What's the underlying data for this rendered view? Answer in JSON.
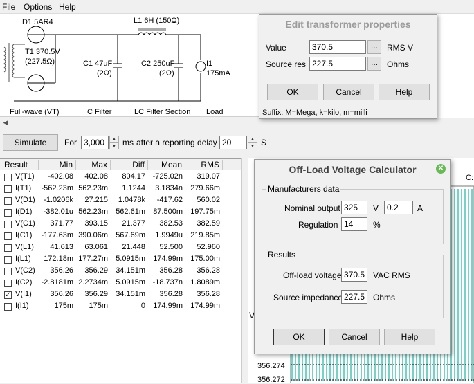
{
  "menu": {
    "file": "File",
    "options": "Options",
    "help": "Help"
  },
  "schematic": {
    "diode": "D1 5AR4",
    "transformer_line1": "T1 370.5V",
    "transformer_line2": "(227.5Ω)",
    "inductor": "L1 6H (150Ω)",
    "c1_line1": "C1 47uF",
    "c1_line2": "(2Ω)",
    "c2_line1": "C2 250uF",
    "c2_line2": "(2Ω)",
    "load_line1": "I1",
    "load_line2": "175mA",
    "caption_fullwave": "Full-wave (VT)",
    "caption_cfilter": "C Filter",
    "caption_lcfilter": "LC Filter Section",
    "caption_load": "Load"
  },
  "toolbar": {
    "simulate": "Simulate",
    "for_label": "For",
    "duration": "3,000",
    "ms_label": "ms",
    "delay_label": "after a reporting delay of",
    "delay": "20",
    "s_label": "S"
  },
  "table": {
    "headers": [
      "Result",
      "Min",
      "Max",
      "Diff",
      "Mean",
      "RMS"
    ],
    "rows": [
      {
        "checked": false,
        "name": "V(T1)",
        "min": "-402.08",
        "max": "402.08",
        "diff": "804.17",
        "mean": "-725.02n",
        "rms": "319.07"
      },
      {
        "checked": false,
        "name": "I(T1)",
        "min": "-562.23m",
        "max": "562.23m",
        "diff": "1.1244",
        "mean": "3.1834n",
        "rms": "279.66m"
      },
      {
        "checked": false,
        "name": "V(D1)",
        "min": "-1.0206k",
        "max": "27.215",
        "diff": "1.0478k",
        "mean": "-417.62",
        "rms": "560.02"
      },
      {
        "checked": false,
        "name": "I(D1)",
        "min": "-382.01u",
        "max": "562.23m",
        "diff": "562.61m",
        "mean": "87.500m",
        "rms": "197.75m"
      },
      {
        "checked": false,
        "name": "V(C1)",
        "min": "371.77",
        "max": "393.15",
        "diff": "21.377",
        "mean": "382.53",
        "rms": "382.59"
      },
      {
        "checked": false,
        "name": "I(C1)",
        "min": "-177.63m",
        "max": "390.06m",
        "diff": "567.69m",
        "mean": "1.9949u",
        "rms": "219.85m"
      },
      {
        "checked": false,
        "name": "V(L1)",
        "min": "41.613",
        "max": "63.061",
        "diff": "21.448",
        "mean": "52.500",
        "rms": "52.960"
      },
      {
        "checked": false,
        "name": "I(L1)",
        "min": "172.18m",
        "max": "177.27m",
        "diff": "5.0915m",
        "mean": "174.99m",
        "rms": "175.00m"
      },
      {
        "checked": false,
        "name": "V(C2)",
        "min": "356.26",
        "max": "356.29",
        "diff": "34.151m",
        "mean": "356.28",
        "rms": "356.28"
      },
      {
        "checked": false,
        "name": "I(C2)",
        "min": "-2.8181m",
        "max": "2.2734m",
        "diff": "5.0915m",
        "mean": "-18.737n",
        "rms": "1.8089m"
      },
      {
        "checked": true,
        "name": "V(I1)",
        "min": "356.26",
        "max": "356.29",
        "diff": "34.151m",
        "mean": "356.28",
        "rms": "356.28"
      },
      {
        "checked": false,
        "name": "I(I1)",
        "min": "175m",
        "max": "175m",
        "diff": "0",
        "mean": "174.99m",
        "rms": "174.99m"
      }
    ]
  },
  "plot": {
    "corner_label": "C:",
    "side_label": "V",
    "tick1": "356.274",
    "tick2": "356.272"
  },
  "transformer_dialog": {
    "title": "Edit transformer properties",
    "value_label": "Value",
    "value": "370.5",
    "value_unit": "RMS V",
    "source_label": "Source res",
    "source": "227.5",
    "source_unit": "Ohms",
    "browse": "...",
    "ok": "OK",
    "cancel": "Cancel",
    "help": "Help",
    "suffix": "Suffix: M=Mega, k=kilo, m=milli"
  },
  "calc_dialog": {
    "title": "Off-Load Voltage Calculator",
    "manufacturers_group": "Manufacturers data",
    "nominal_label": "Nominal output",
    "nominal_value": "325",
    "v_unit": "V",
    "current_value": "0.2",
    "a_unit": "A",
    "regulation_label": "Regulation",
    "regulation_value": "14",
    "percent": "%",
    "results_group": "Results",
    "offload_label": "Off-load voltage",
    "offload_value": "370.5",
    "offload_unit": "VAC RMS",
    "impedance_label": "Source impedance",
    "impedance_value": "227.5",
    "impedance_unit": "Ohms",
    "ok": "OK",
    "cancel": "Cancel",
    "help": "Help"
  },
  "colors": {
    "trace": "#19b3a0",
    "close": "#66bb55"
  }
}
